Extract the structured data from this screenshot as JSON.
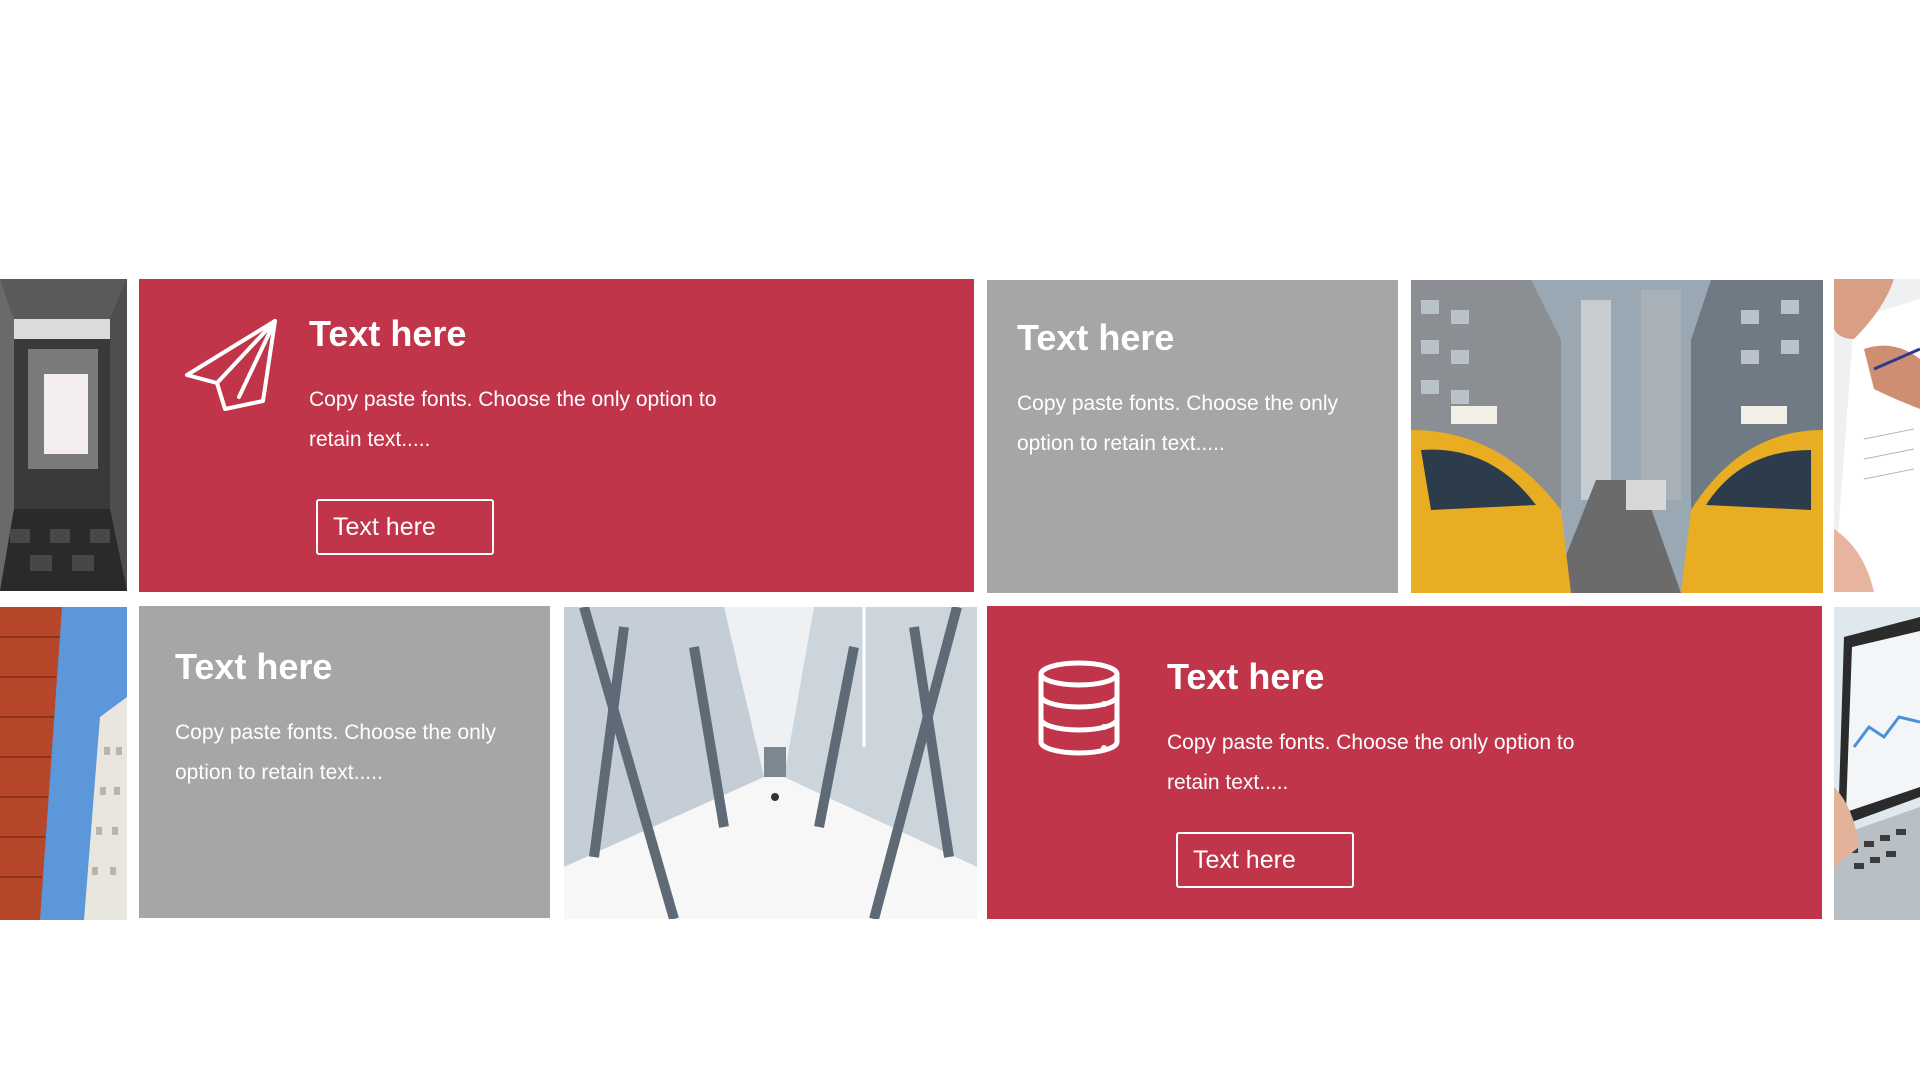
{
  "cards": [
    {
      "id": "top-red",
      "icon": "paper-plane-icon",
      "heading": "Text here",
      "body": "Copy paste fonts. Choose the only option to retain text.....",
      "button_label": "Text here",
      "color": "#c0354a"
    },
    {
      "id": "top-gray",
      "heading": "Text here",
      "body": "Copy paste fonts. Choose the only option to retain text.....",
      "color": "#a6a6a6"
    },
    {
      "id": "bottom-gray",
      "heading": "Text here",
      "body": "Copy paste fonts. Choose the only option to retain text.....",
      "color": "#a6a6a6"
    },
    {
      "id": "bottom-red",
      "icon": "database-icon",
      "heading": "Text here",
      "body": "Copy paste fonts. Choose the only option to retain text.....",
      "button_label": "Text here",
      "color": "#c0354a"
    }
  ],
  "photos": [
    {
      "id": "photo-corridor-dark",
      "subject": "concrete-tunnel"
    },
    {
      "id": "photo-taxis",
      "subject": "city-street-taxis"
    },
    {
      "id": "photo-hands-paper",
      "subject": "hands-with-document"
    },
    {
      "id": "photo-building-sky",
      "subject": "red-building-sky"
    },
    {
      "id": "photo-glass-walkway",
      "subject": "glass-walkway"
    },
    {
      "id": "photo-laptop",
      "subject": "laptop-hands"
    }
  ]
}
